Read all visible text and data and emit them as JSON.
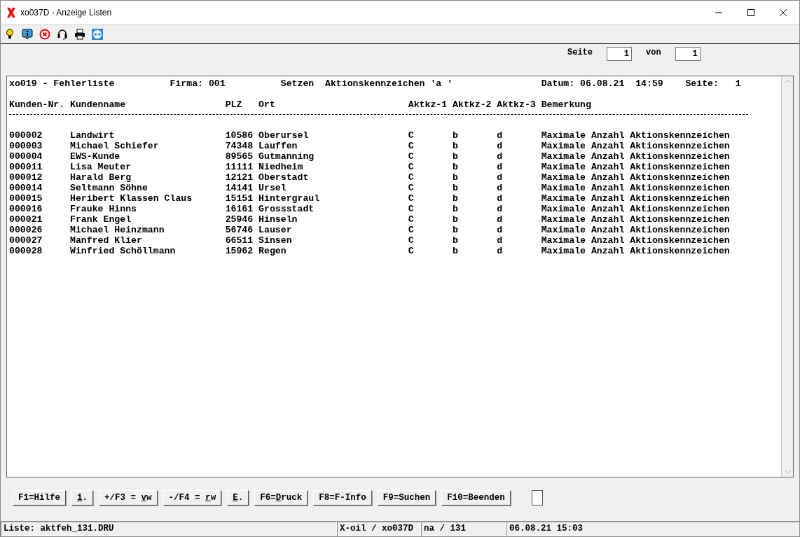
{
  "window": {
    "title": "xo037D - Anzeige Listen"
  },
  "pager": {
    "label": "Seite",
    "page": "1",
    "of_label": "von",
    "total": "1"
  },
  "report": {
    "header": [
      {
        "text": "xo019 - Fehlerliste"
      },
      {
        "text": "Firma: 001"
      },
      {
        "text": "Setzen"
      },
      {
        "text": "Aktionskennzeichen 'a '"
      },
      {
        "text": "Datum: 06.08.21"
      },
      {
        "text": "14:59"
      },
      {
        "text": "Seite:"
      },
      {
        "text": "1"
      }
    ],
    "columns": [
      "Kunden-Nr.",
      "Kundenname",
      "PLZ",
      "Ort",
      "Aktkz-1",
      "Aktkz-2",
      "Aktkz-3",
      "Bemerkung"
    ],
    "rows": [
      [
        "000002",
        "Landwirt",
        "10586",
        "Oberursel",
        "C",
        "b",
        "d",
        "Maximale Anzahl Aktionskennzeichen"
      ],
      [
        "000003",
        "Michael Schiefer",
        "74348",
        "Lauffen",
        "C",
        "b",
        "d",
        "Maximale Anzahl Aktionskennzeichen"
      ],
      [
        "000004",
        "EWS-Kunde",
        "89565",
        "Gutmanning",
        "C",
        "b",
        "d",
        "Maximale Anzahl Aktionskennzeichen"
      ],
      [
        "000011",
        "Lisa Meuter",
        "11111",
        "Niedheim",
        "C",
        "b",
        "d",
        "Maximale Anzahl Aktionskennzeichen"
      ],
      [
        "000012",
        "Harald Berg",
        "12121",
        "Oberstadt",
        "C",
        "b",
        "d",
        "Maximale Anzahl Aktionskennzeichen"
      ],
      [
        "000014",
        "Seltmann Söhne",
        "14141",
        "Ursel",
        "C",
        "b",
        "d",
        "Maximale Anzahl Aktionskennzeichen"
      ],
      [
        "000015",
        "Heribert Klassen Claus",
        "15151",
        "Hintergraul",
        "C",
        "b",
        "d",
        "Maximale Anzahl Aktionskennzeichen"
      ],
      [
        "000016",
        "Frauke Hinns",
        "16161",
        "Grossstadt",
        "C",
        "b",
        "d",
        "Maximale Anzahl Aktionskennzeichen"
      ],
      [
        "000021",
        "Frank Engel",
        "25946",
        "Hinseln",
        "C",
        "b",
        "d",
        "Maximale Anzahl Aktionskennzeichen"
      ],
      [
        "000026",
        "Michael Heinzmann",
        "56746",
        "Lauser",
        "C",
        "b",
        "d",
        "Maximale Anzahl Aktionskennzeichen"
      ],
      [
        "000027",
        "Manfred Klier",
        "66511",
        "Sinsen",
        "C",
        "b",
        "d",
        "Maximale Anzahl Aktionskennzeichen"
      ],
      [
        "000028",
        "Winfried Schöllmann",
        "15962",
        "Regen",
        "C",
        "b",
        "d",
        "Maximale Anzahl Aktionskennzeichen"
      ]
    ]
  },
  "buttons": [
    {
      "pre": "F1=Hilfe"
    },
    {
      "key": "1",
      "post": "."
    },
    {
      "pre": "+/F3 = ",
      "key": "v",
      "post": "w"
    },
    {
      "pre": "-/F4 = ",
      "key": "r",
      "post": "w"
    },
    {
      "key": "E",
      "post": "."
    },
    {
      "pre": "F6=",
      "key": "D",
      "post": "ruck"
    },
    {
      "pre": "F8=F-Info"
    },
    {
      "pre": "F9=Suchen"
    },
    {
      "pre": "F10=Beenden"
    }
  ],
  "status_bar": [
    "Liste: aktfeh_131.DRU",
    "X-oil / xo037D",
    "na / 131",
    "06.08.21 15:03"
  ]
}
